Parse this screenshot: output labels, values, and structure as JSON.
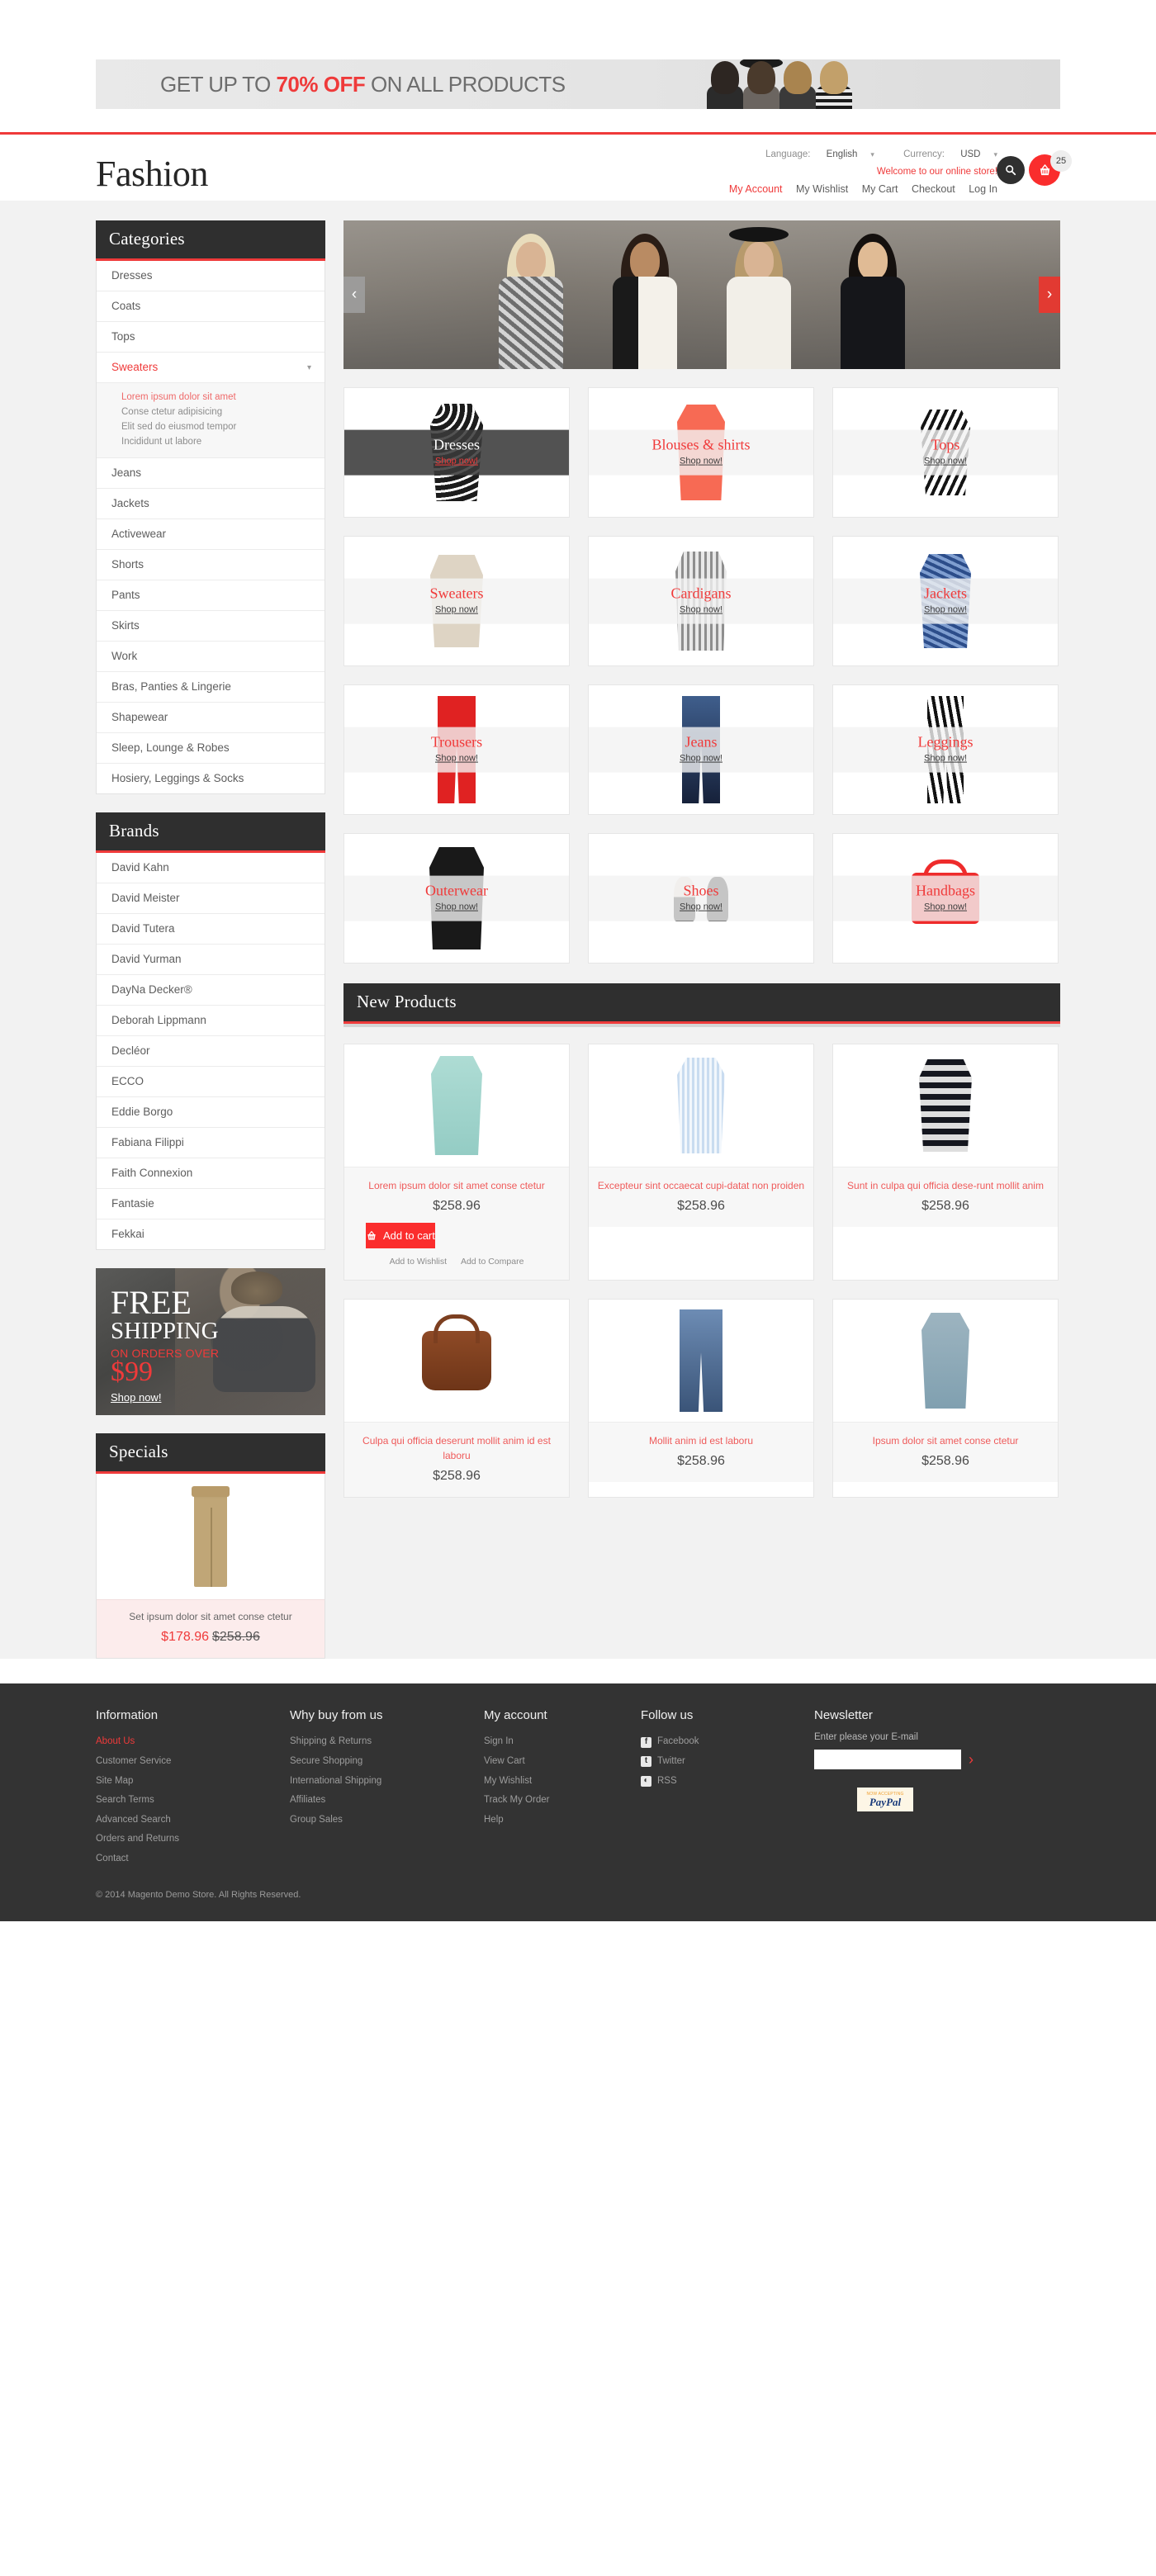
{
  "promo": {
    "text_before": "GET UP TO ",
    "highlight": "70% OFF",
    "text_after": " ON ALL PRODUCTS"
  },
  "header": {
    "logo": "Fashion",
    "language_label": "Language:",
    "language_value": "English",
    "currency_label": "Currency:",
    "currency_value": "USD",
    "welcome": "Welcome to our online store!",
    "links": [
      {
        "label": "My Account",
        "active": true
      },
      {
        "label": "My Wishlist",
        "active": false
      },
      {
        "label": "My Cart",
        "active": false
      },
      {
        "label": "Checkout",
        "active": false
      },
      {
        "label": "Log In",
        "active": false
      }
    ],
    "search_icon": "search-icon",
    "cart_icon": "cart-icon",
    "cart_count": "25"
  },
  "sidebar": {
    "categories_title": "Categories",
    "categories": [
      {
        "label": "Dresses",
        "active": false,
        "expandable": false
      },
      {
        "label": "Coats",
        "active": false,
        "expandable": false
      },
      {
        "label": "Tops",
        "active": false,
        "expandable": false
      },
      {
        "label": "Sweaters",
        "active": true,
        "expandable": true
      },
      {
        "label": "Jeans",
        "active": false,
        "expandable": false
      },
      {
        "label": "Jackets",
        "active": false,
        "expandable": false
      },
      {
        "label": "Activewear",
        "active": false,
        "expandable": false
      },
      {
        "label": "Shorts",
        "active": false,
        "expandable": false
      },
      {
        "label": "Pants",
        "active": false,
        "expandable": false
      },
      {
        "label": "Skirts",
        "active": false,
        "expandable": false
      },
      {
        "label": "Work",
        "active": false,
        "expandable": false
      },
      {
        "label": "Bras, Panties & Lingerie",
        "active": false,
        "expandable": false
      },
      {
        "label": "Shapewear",
        "active": false,
        "expandable": false
      },
      {
        "label": "Sleep, Lounge & Robes",
        "active": false,
        "expandable": false
      },
      {
        "label": "Hosiery, Leggings & Socks",
        "active": false,
        "expandable": false
      }
    ],
    "subcategories": [
      {
        "label": "Lorem ipsum dolor sit amet",
        "active": true
      },
      {
        "label": "Conse ctetur adipisicing",
        "active": false
      },
      {
        "label": "Elit sed do eiusmod tempor",
        "active": false
      },
      {
        "label": "Incididunt ut labore",
        "active": false
      }
    ],
    "brands_title": "Brands",
    "brands": [
      "David Kahn",
      "David Meister",
      "David Tutera",
      "David Yurman",
      "DayNa Decker®",
      "Deborah Lippmann",
      "Decléor",
      "ECCO",
      "Eddie Borgo",
      "Fabiana Filippi",
      "Faith Connexion",
      "Fantasie",
      "Fekkai"
    ],
    "shipping_banner": {
      "line1": "FREE",
      "line2": "SHIPPING",
      "line3": "ON ORDERS OVER",
      "amount": "$99",
      "cta": "Shop now!"
    },
    "specials_title": "Specials",
    "special_product": {
      "name": "Set ipsum dolor sit amet conse ctetur",
      "price_special": "$178.96",
      "price_old": "$258.96"
    }
  },
  "hero": {
    "prev_icon": "chevron-left-icon",
    "next_icon": "chevron-right-icon",
    "prev_label": "‹",
    "next_label": "›"
  },
  "tiles": [
    {
      "label": "Dresses",
      "cta": "Shop now!",
      "dark": true,
      "art": "g-dress"
    },
    {
      "label": "Blouses & shirts",
      "cta": "Shop now!",
      "dark": false,
      "art": "g-blouse"
    },
    {
      "label": "Tops",
      "cta": "Shop now!",
      "dark": false,
      "art": "g-top"
    },
    {
      "label": "Sweaters",
      "cta": "Shop now!",
      "dark": false,
      "art": "g-sweater"
    },
    {
      "label": "Cardigans",
      "cta": "Shop now!",
      "dark": false,
      "art": "g-cardigan"
    },
    {
      "label": "Jackets",
      "cta": "Shop now!",
      "dark": false,
      "art": "g-jacket"
    },
    {
      "label": "Trousers",
      "cta": "Shop now!",
      "dark": false,
      "art": "g-trousers"
    },
    {
      "label": "Jeans",
      "cta": "Shop now!",
      "dark": false,
      "art": "g-jeans"
    },
    {
      "label": "Leggings",
      "cta": "Shop now!",
      "dark": false,
      "art": "g-leggings"
    },
    {
      "label": "Outerwear",
      "cta": "Shop now!",
      "dark": false,
      "art": "g-outerwear"
    },
    {
      "label": "Shoes",
      "cta": "Shop now!",
      "dark": false,
      "art": "g-shoes"
    },
    {
      "label": "Handbags",
      "cta": "Shop now!",
      "dark": false,
      "art": "g-handbag"
    }
  ],
  "new_products": {
    "title": "New Products",
    "add_to_cart_label": "Add to cart",
    "cart_icon": "cart-icon",
    "wishlist_label": "Add to Wishlist",
    "compare_label": "Add to Compare",
    "items": [
      {
        "name": "Lorem ipsum dolor sit amet conse ctetur",
        "price": "$258.96",
        "art": "p-coat",
        "featured": true
      },
      {
        "name": "Excepteur sint occaecat cupi-datat non proiden",
        "price": "$258.96",
        "art": "p-shirt1",
        "featured": false
      },
      {
        "name": "Sunt in culpa qui officia dese-runt mollit anim",
        "price": "$258.96",
        "art": "p-stripe",
        "featured": false
      },
      {
        "name": "Culpa qui officia deserunt mollit anim id est laboru",
        "price": "$258.96",
        "art": "p-bag",
        "featured": false
      },
      {
        "name": "Mollit anim id est laboru",
        "price": "$258.96",
        "art": "p-jeans",
        "featured": false
      },
      {
        "name": "Ipsum dolor sit amet conse ctetur",
        "price": "$258.96",
        "art": "p-shirt2",
        "featured": false
      }
    ]
  },
  "footer": {
    "columns": [
      {
        "title": "Information",
        "links": [
          {
            "label": "About Us",
            "active": true
          },
          {
            "label": "Customer Service",
            "active": false
          },
          {
            "label": "Site Map",
            "active": false
          },
          {
            "label": "Search Terms",
            "active": false
          },
          {
            "label": "Advanced Search",
            "active": false
          },
          {
            "label": "Orders and Returns",
            "active": false
          },
          {
            "label": "Contact",
            "active": false
          }
        ]
      },
      {
        "title": "Why buy from us",
        "links": [
          {
            "label": "Shipping & Returns",
            "active": false
          },
          {
            "label": "Secure Shopping",
            "active": false
          },
          {
            "label": "International Shipping",
            "active": false
          },
          {
            "label": "Affiliates",
            "active": false
          },
          {
            "label": "Group Sales",
            "active": false
          }
        ]
      },
      {
        "title": "My account",
        "links": [
          {
            "label": "Sign In",
            "active": false
          },
          {
            "label": "View Cart",
            "active": false
          },
          {
            "label": "My Wishlist",
            "active": false
          },
          {
            "label": "Track My Order",
            "active": false
          },
          {
            "label": "Help",
            "active": false
          }
        ]
      }
    ],
    "follow_title": "Follow us",
    "social": [
      {
        "label": "Facebook",
        "glyph": "f",
        "icon": "facebook-icon"
      },
      {
        "label": "Twitter",
        "glyph": "t",
        "icon": "twitter-icon"
      },
      {
        "label": "RSS",
        "glyph": "◔",
        "icon": "rss-icon"
      }
    ],
    "newsletter_title": "Newsletter",
    "newsletter_label": "Enter please your E-mail",
    "newsletter_value": "",
    "newsletter_placeholder": "",
    "newsletter_submit": "›",
    "paypal_top": "NOW ACCEPTING",
    "paypal_main": "PayPal",
    "copyright": "© 2014 Magento Demo Store. All Rights Reserved."
  },
  "colors": {
    "accent": "#ef3a3a",
    "cart_red": "#fa2d2d",
    "dark": "#2f2f2f",
    "footer": "#333333"
  }
}
